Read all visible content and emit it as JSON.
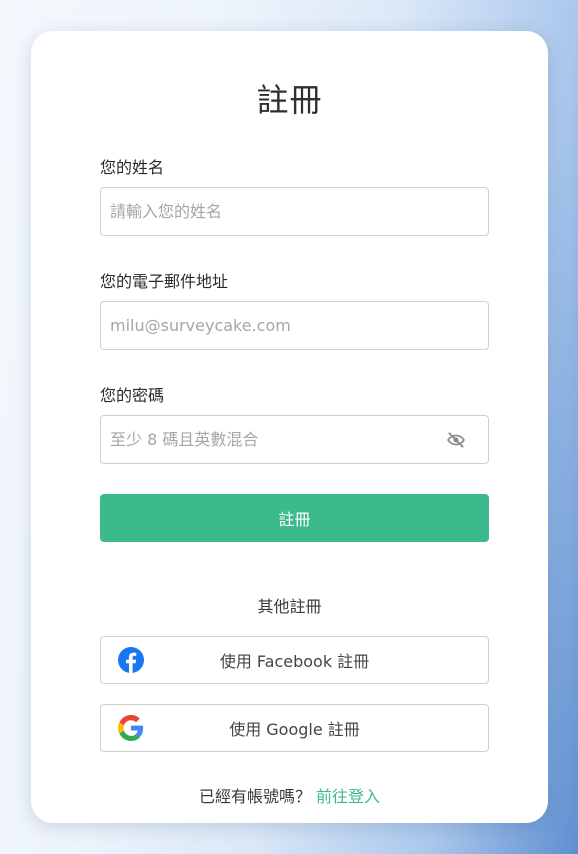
{
  "form": {
    "title": "註冊",
    "name_label": "您的姓名",
    "name_placeholder": "請輸入您的姓名",
    "email_label": "您的電子郵件地址",
    "email_placeholder": "milu@surveycake.com",
    "password_label": "您的密碼",
    "password_placeholder": "至少 8 碼且英數混合",
    "submit_label": "註冊"
  },
  "social": {
    "heading": "其他註冊",
    "facebook_label": "使用 Facebook 註冊",
    "google_label": "使用 Google 註冊"
  },
  "footer": {
    "prompt": "已經有帳號嗎？",
    "login_link": "前往登入"
  },
  "colors": {
    "accent": "#3dba8c",
    "facebook": "#1877f2"
  },
  "icons": {
    "password_toggle": "eye-off-icon",
    "facebook": "facebook-icon",
    "google": "google-icon"
  }
}
